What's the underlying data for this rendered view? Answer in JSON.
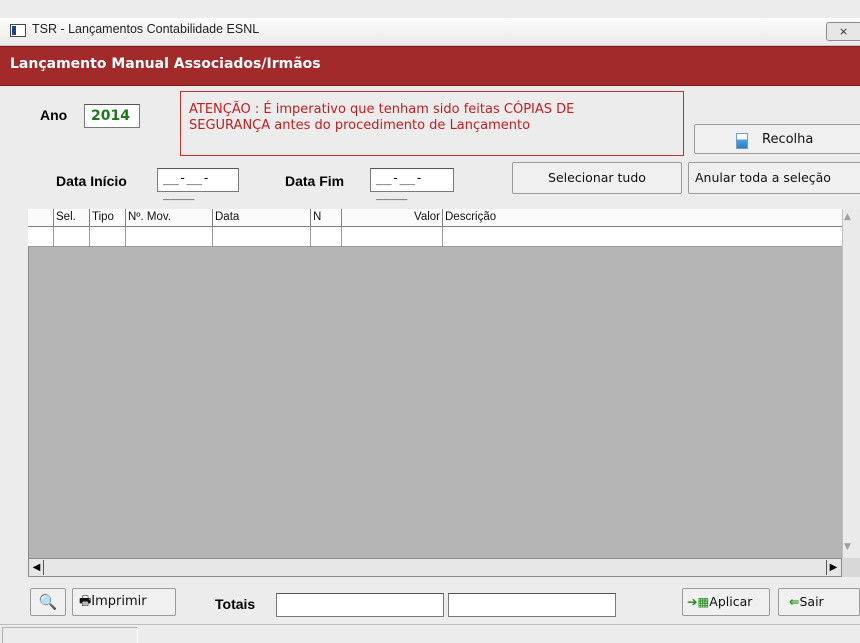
{
  "window": {
    "title": "TSR - Lançamentos Contabilidade ESNL",
    "close_glyph": "⨯"
  },
  "header": {
    "title": "Lançamento Manual Associados/Irmãos"
  },
  "form": {
    "ano_label": "Ano",
    "ano_value": "2014",
    "warning_line1": "ATENÇÃO : É imperativo que tenham sido feitas CÓPIAS DE",
    "warning_line2": "SEGURANÇA antes do  procedimento de Lançamento",
    "recolha_label": "Recolha",
    "data_inicio_label": "Data Início",
    "data_inicio_value": "__-__-____",
    "data_fim_label": "Data Fim",
    "data_fim_value": "__-__-____",
    "selecionar_label": "Selecionar tudo",
    "anular_label": "Anular toda a seleção"
  },
  "grid": {
    "columns": [
      "Sel.",
      "Tipo",
      "Nº. Mov.",
      "Data",
      "N",
      "Valor",
      "Descrição"
    ],
    "rows": []
  },
  "footer": {
    "imprimir_label": "Imprimir",
    "totais_label": "Totais",
    "total1_value": "",
    "total2_value": "",
    "aplicar_label": "Aplicar",
    "sair_label": "Sair"
  },
  "icons": {
    "app": "app-window-icon",
    "recolha": "document-icon",
    "preview": "print-preview-icon",
    "imprimir": "printer-icon",
    "aplicar": "apply-grid-icon",
    "sair": "exit-door-icon"
  }
}
